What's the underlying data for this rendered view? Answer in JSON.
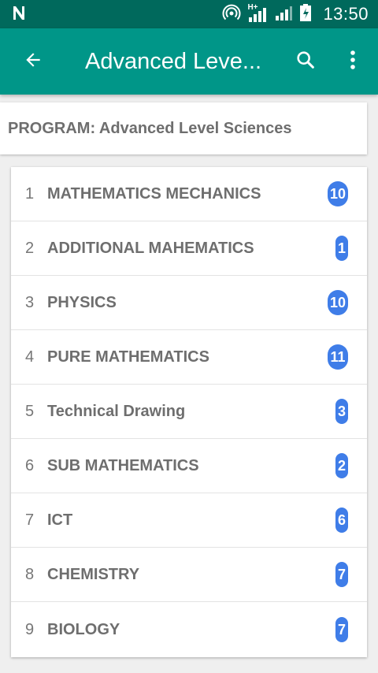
{
  "status_bar": {
    "time": "13:50",
    "network_label": "H+",
    "icons": [
      "n-app-icon",
      "hotspot-icon",
      "signal-icon",
      "signal-icon-2",
      "battery-icon"
    ]
  },
  "toolbar": {
    "title": "Advanced Leve...",
    "back_icon": "arrow-back-icon",
    "search_icon": "search-icon",
    "more_icon": "more-vert-icon",
    "color": "#009688"
  },
  "program": {
    "label": "PROGRAM: Advanced Level Sciences"
  },
  "subjects": [
    {
      "number": "1",
      "name": "MATHEMATICS MECHANICS",
      "count": "10"
    },
    {
      "number": "2",
      "name": "ADDITIONAL MAHEMATICS",
      "count": "1"
    },
    {
      "number": "3",
      "name": "PHYSICS",
      "count": "10"
    },
    {
      "number": "4",
      "name": "PURE MATHEMATICS",
      "count": "11"
    },
    {
      "number": "5",
      "name": "Technical Drawing",
      "count": "3"
    },
    {
      "number": "6",
      "name": "SUB MATHEMATICS",
      "count": "2"
    },
    {
      "number": "7",
      "name": "ICT",
      "count": "6"
    },
    {
      "number": "8",
      "name": "CHEMISTRY",
      "count": "7"
    },
    {
      "number": "9",
      "name": "BIOLOGY",
      "count": "7"
    }
  ],
  "colors": {
    "status_bar": "#00695c",
    "toolbar": "#009688",
    "badge": "#3f7de8"
  }
}
